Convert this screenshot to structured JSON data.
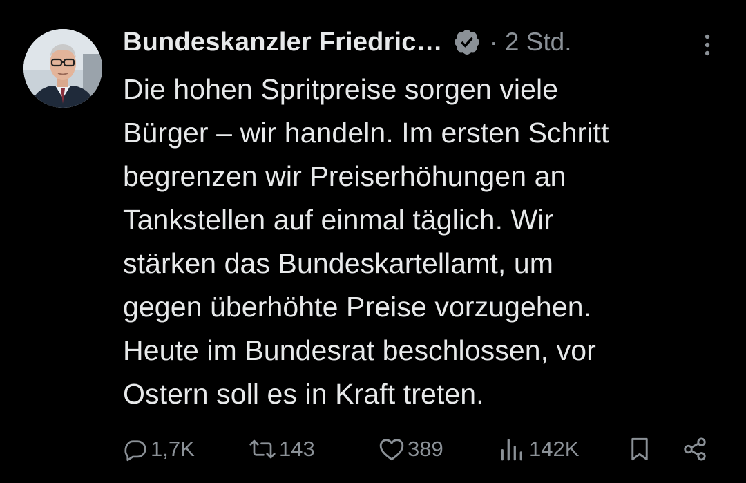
{
  "post": {
    "author": {
      "display_name": "Bundeskanzler Friedric…",
      "verified_icon": "verified-badge-icon",
      "avatar_icon": "avatar-photo"
    },
    "separator": "·",
    "timestamp": "2 Std.",
    "text": "Die hohen Spritpreise sorgen viele\nBürger – wir handeln. Im ersten Schritt\nbegrenzen wir Preiserhöhungen an\nTankstellen auf einmal täglich. Wir\nstärken das Bundeskartellamt, um\ngegen überhöhte Preise vorzugehen.\nHeute im Bundesrat beschlossen, vor\nOstern soll es in Kraft treten.",
    "actions": {
      "replies": "1,7K",
      "reposts": "143",
      "likes": "389",
      "views": "142K"
    }
  },
  "colors": {
    "background": "#000000",
    "text": "#e7e9ea",
    "muted": "#8b9197",
    "verified_badge": "#8b9197"
  }
}
